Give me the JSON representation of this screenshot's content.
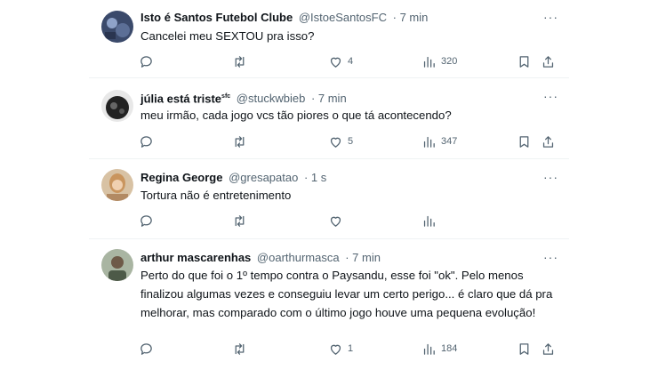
{
  "tweets": [
    {
      "name": "Isto é Santos Futebol Clube",
      "handle": "@IstoeSantosFC",
      "time": "· 7 min",
      "text": "Cancelei meu SEXTOU pra isso?",
      "likes": "4",
      "views": "320",
      "avatar_color": "#3b4a6b"
    },
    {
      "name": "júlia está triste",
      "name_suffix": "sfc",
      "handle": "@stuckwbieb",
      "time": "· 7 min",
      "text": "meu irmão, cada jogo vcs tão piores o que tá acontecendo?",
      "likes": "5",
      "views": "347",
      "avatar_color": "#2a2a2a"
    },
    {
      "name": "Regina George",
      "handle": "@gresapatao",
      "time": "· 1 s",
      "text": "Tortura não é entretenimento",
      "avatar_color": "#c9a27a"
    },
    {
      "name": "arthur mascarenhas",
      "handle": "@oarthurmasca",
      "time": "· 7 min",
      "text": "Perto do que foi o 1º tempo contra o Paysandu, esse foi \"ok\". Pelo menos finalizou algumas vezes e conseguiu levar um certo perigo... é claro que dá pra melhorar, mas comparado com o último jogo houve uma pequena evolução!",
      "likes": "1",
      "views": "184",
      "avatar_color": "#8a9a86"
    }
  ],
  "more_label": "···",
  "colors": {
    "text": "#0f1419",
    "secondary": "#536471",
    "divider": "#eff3f4"
  },
  "icons": [
    "reply-icon",
    "retweet-icon",
    "like-icon",
    "views-icon",
    "bookmark-icon",
    "share-icon"
  ]
}
